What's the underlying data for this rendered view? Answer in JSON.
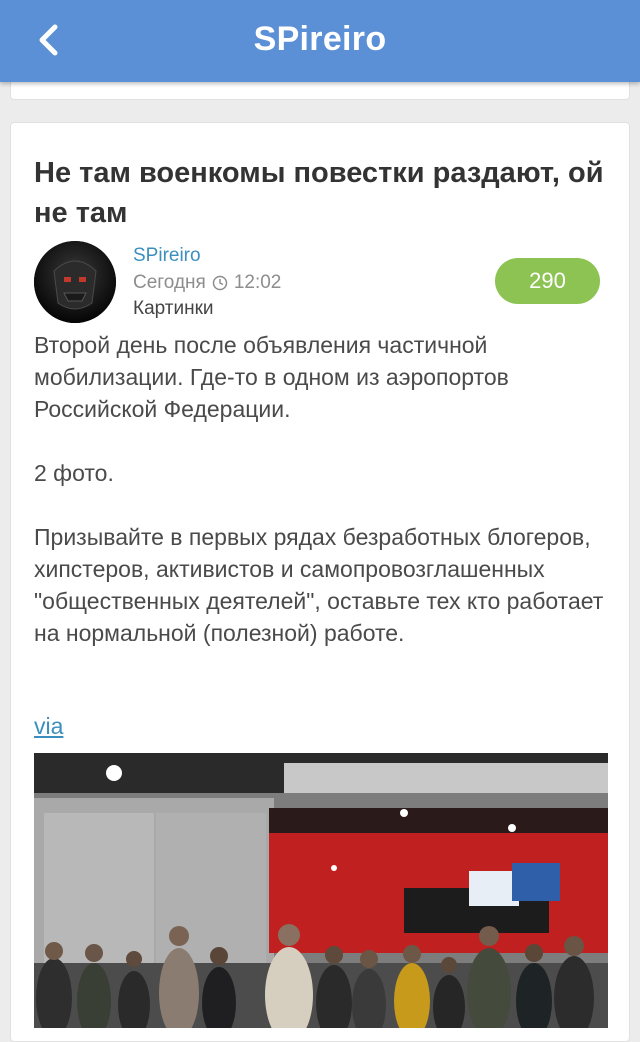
{
  "header": {
    "title": "SPireiro",
    "back_icon": "chevron-left-icon",
    "bg_color": "#5b8fd6"
  },
  "post": {
    "title": "Не там военкомы повестки раздают, ой не там",
    "author": "SPireiro",
    "date": "Сегодня",
    "time": "12:02",
    "category": "Картинки",
    "rating": "290",
    "rating_color": "#8cc353",
    "paragraphs": [
      "Второй день после объявления частичной мобилизации. Где-то в одном из аэропортов Российской Федерации.",
      "2 фото.",
      "Призывайте в первых рядах безработных блогеров, хипстеров, активистов и самопровозглашенных \"общественных деятелей\", оставьте тех кто работает на нормальной (полезной) работе."
    ],
    "via_label": "via"
  }
}
